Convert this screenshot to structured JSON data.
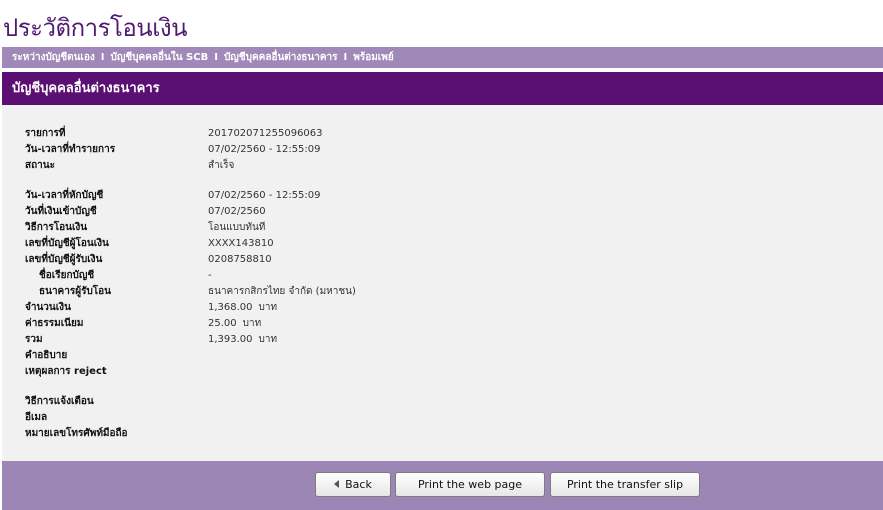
{
  "page": {
    "title": "ประวัติการโอนเงิน"
  },
  "nav": {
    "items": [
      "ระหว่างบัญชีตนเอง",
      "บัญชีบุคคลอื่นใน SCB",
      "บัญชีบุคคลอื่นต่างธนาคาร",
      "พร้อมเพย์"
    ],
    "separator": "I"
  },
  "section": {
    "title": "บัญชีบุคคลอื่นต่างธนาคาร"
  },
  "details": {
    "ref_label": "รายการที่",
    "ref_value": "201702071255096063",
    "txn_datetime_label": "วัน-เวลาที่ทำรายการ",
    "txn_datetime_value": "07/02/2560 - 12:55:09",
    "status_label": "สถานะ",
    "status_value": "สำเร็จ",
    "debit_datetime_label": "วัน-เวลาที่หักบัญชี",
    "debit_datetime_value": "07/02/2560 - 12:55:09",
    "credit_date_label": "วันที่เงินเข้าบัญชี",
    "credit_date_value": "07/02/2560",
    "method_label": "วิธีการโอนเงิน",
    "method_value": "โอนแบบทันที",
    "from_account_label": "เลขที่บัญชีผู้โอนเงิน",
    "from_account_value": "XXXX143810",
    "to_account_label": "เลขที่บัญชีผู้รับเงิน",
    "to_account_value": "0208758810",
    "nickname_label": "ชื่อเรียกบัญชี",
    "nickname_value": "-",
    "bank_label": "ธนาคารผู้รับโอน",
    "bank_value": "ธนาคารกสิกรไทย จำกัด (มหาชน)",
    "amount_label": "จำนวนเงิน",
    "amount_value": "1,368.00",
    "fee_label": "ค่าธรรมเนียม",
    "fee_value": "25.00",
    "total_label": "รวม",
    "total_value": "1,393.00",
    "currency_unit": "บาท",
    "description_label": "คำอธิบาย",
    "reject_label": "เหตุผลการ reject",
    "notify_label": "วิธีการแจ้งเตือน",
    "email_label": "อีเมล",
    "mobile_label": "หมายเลขโทรศัพท์มือถือ"
  },
  "buttons": {
    "back": "Back",
    "print_page": "Print the web page",
    "print_slip": "Print the transfer slip"
  },
  "colors": {
    "title": "#4f1a71",
    "nav_bar": "#a088b8",
    "header_bar": "#5c0f72",
    "panel_bg": "#f1f1f1",
    "footer_bar": "#9c86b5"
  }
}
